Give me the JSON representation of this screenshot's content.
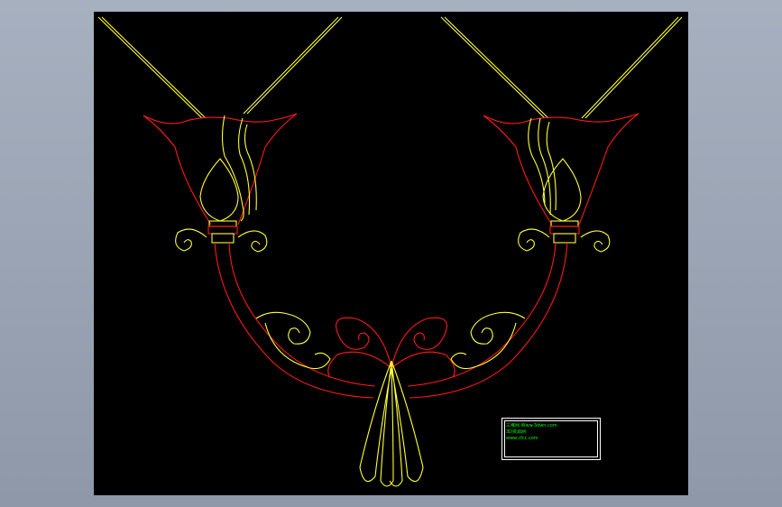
{
  "colors": {
    "background": "#000000",
    "frame": "#a6b0bf",
    "outline_red": "#ff1a1a",
    "outline_yellow": "#ffff33",
    "titleblock_text": "#00ff00",
    "titleblock_border": "#ffffff"
  },
  "title_block": {
    "row1": "三维网 Www.3dwn.com",
    "row2": "3D资源网",
    "row3": "www.cfcc.com",
    "row4": "",
    "row5": "",
    "row6": ""
  }
}
